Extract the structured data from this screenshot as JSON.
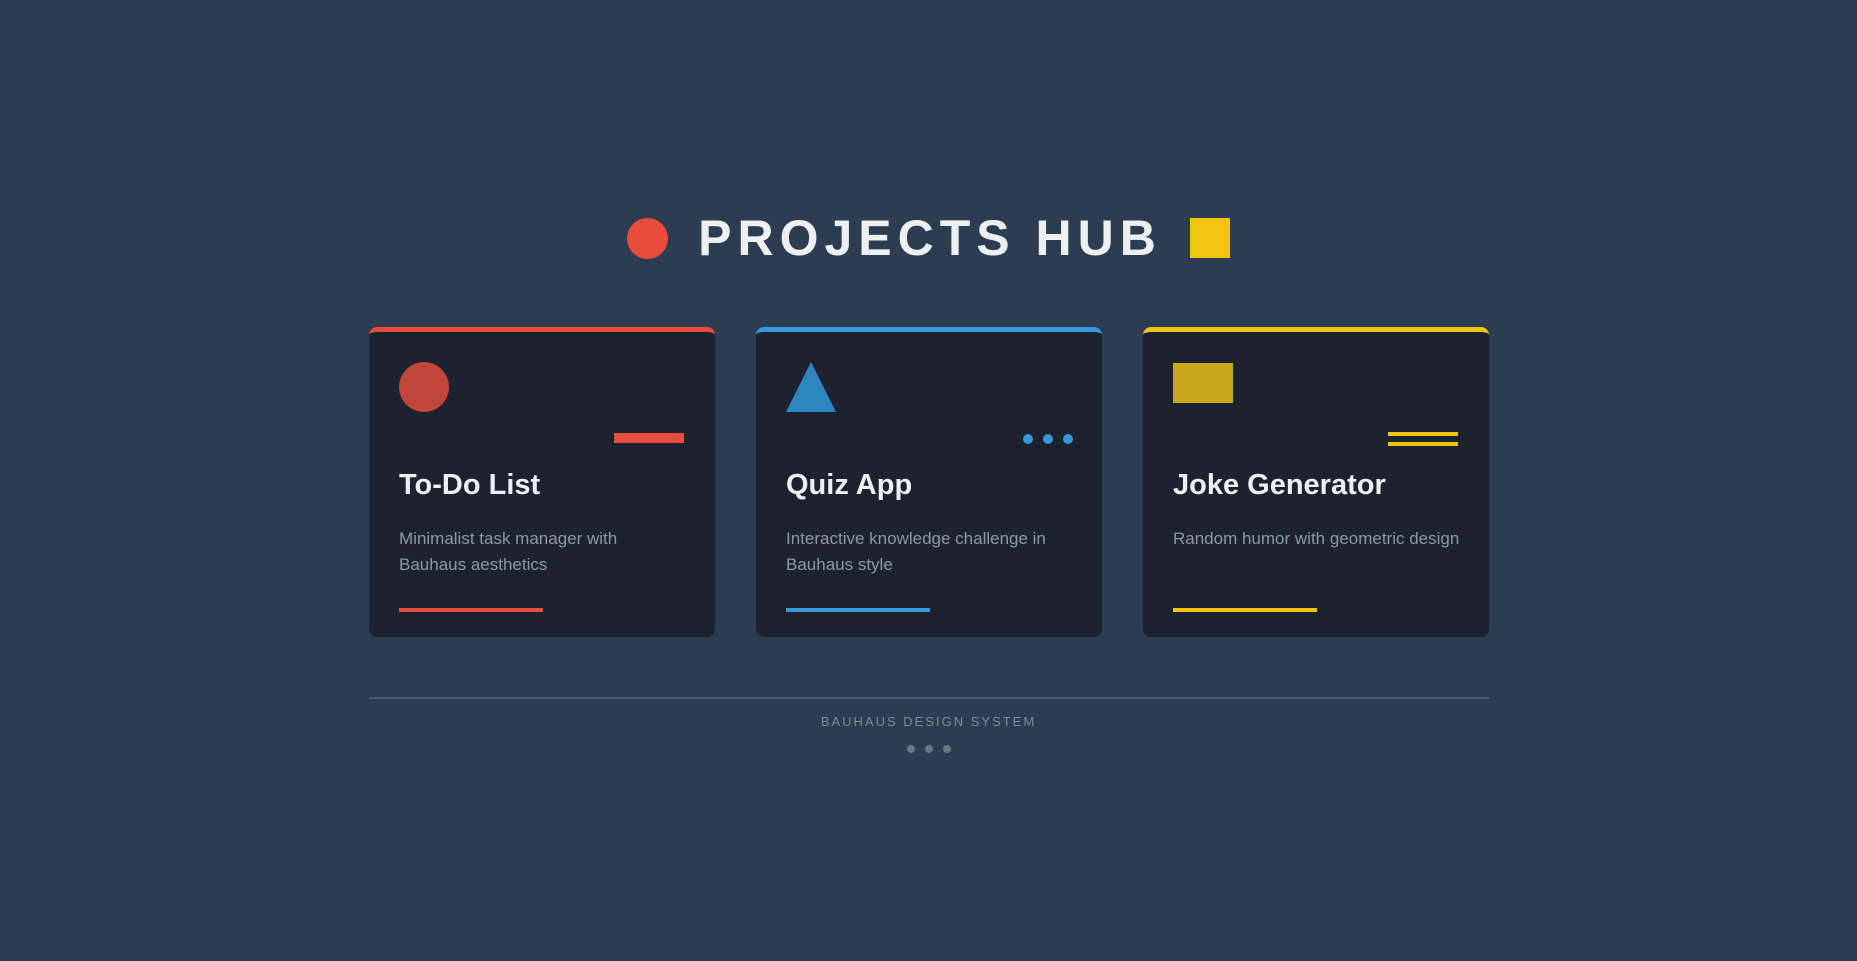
{
  "header": {
    "title": "PROJECTS HUB",
    "circle_color": "#e74c3c",
    "square_color": "#f1c40f"
  },
  "projects": [
    {
      "title": "To-Do List",
      "description": "Minimalist task manager with Bauhaus aesthetics",
      "accent": "#e74c3c",
      "shape": "circle-icon",
      "accent_mark": "bar"
    },
    {
      "title": "Quiz App",
      "description": "Interactive knowledge challenge in Bauhaus style",
      "accent": "#3498db",
      "shape": "triangle-icon",
      "accent_mark": "dots"
    },
    {
      "title": "Joke Generator",
      "description": "Random humor with geometric design",
      "accent": "#f1c40f",
      "shape": "square-icon",
      "accent_mark": "lines"
    }
  ],
  "footer": {
    "text": "BAUHAUS DESIGN SYSTEM",
    "dots_icon": "three-dots-icon"
  },
  "colors": {
    "background": "#2d3d51",
    "card": "#1c232e",
    "text": "#ecf0f1",
    "muted": "#8f979f"
  }
}
